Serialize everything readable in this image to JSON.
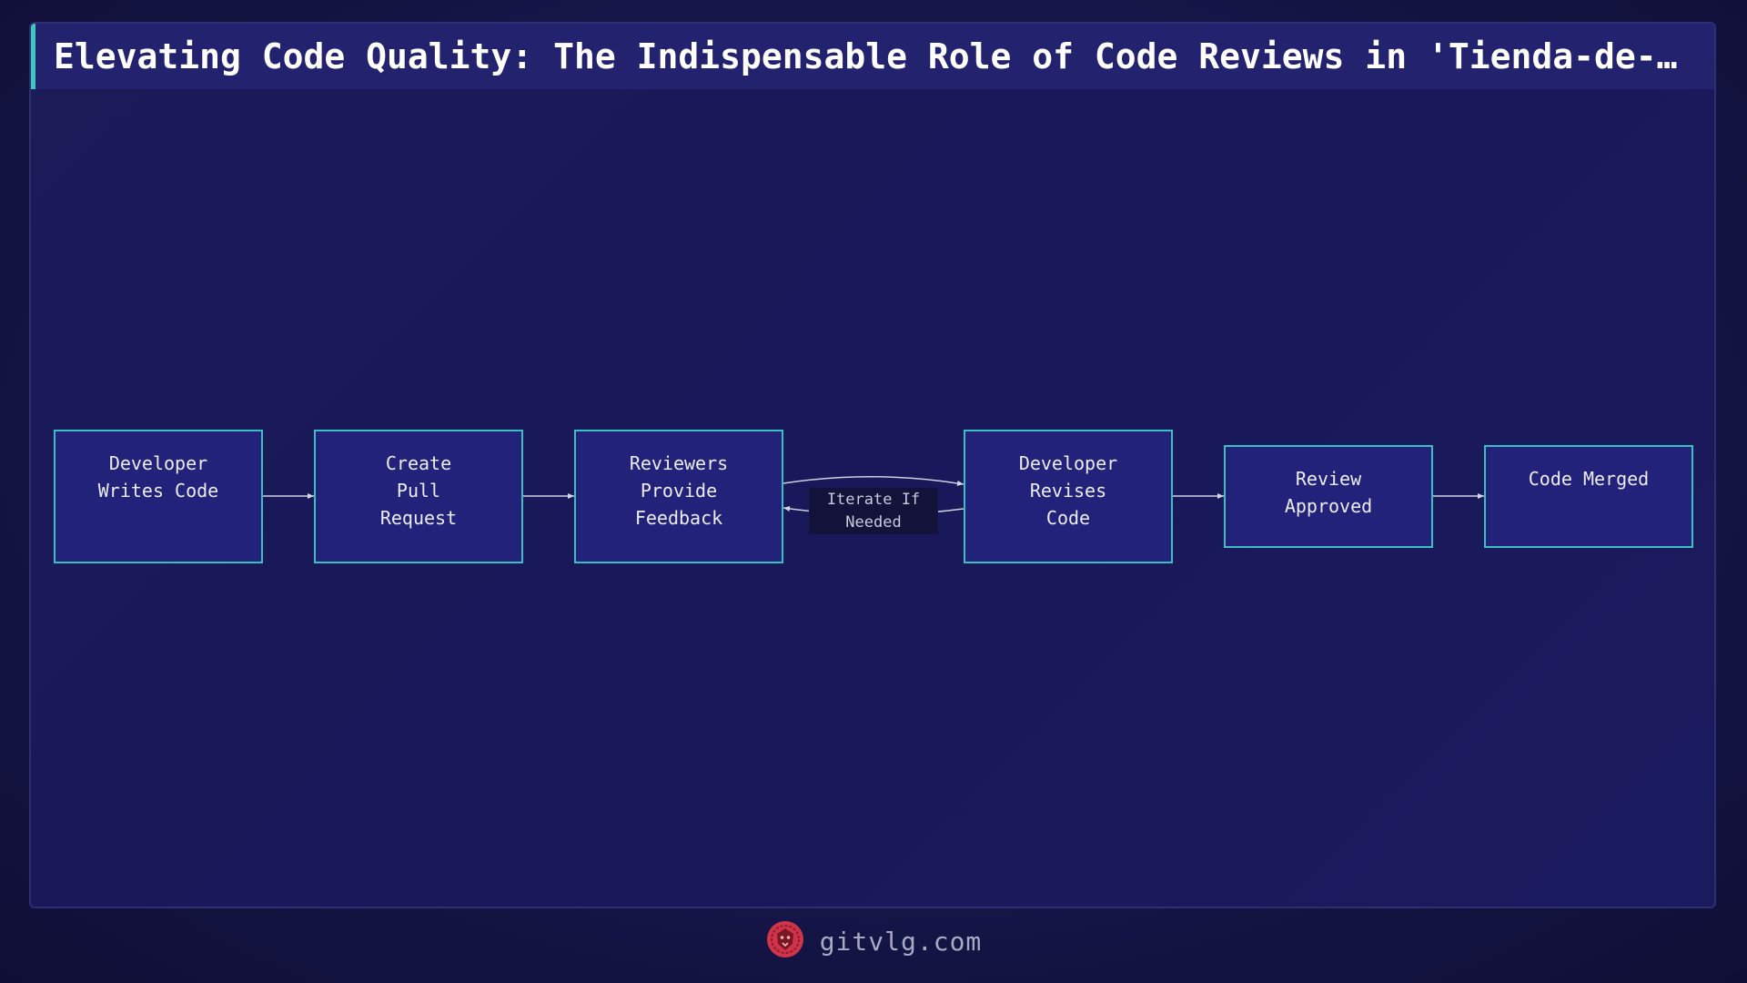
{
  "title": "Elevating Code Quality: The Indispensable Role of Code Reviews in 'Tienda-de-Ro…",
  "nodes": [
    {
      "label": "Developer\nWrites Code"
    },
    {
      "label": "Create\nPull\nRequest"
    },
    {
      "label": "Reviewers\nProvide\nFeedback"
    },
    {
      "label": "Developer\nRevises\nCode"
    },
    {
      "label": "Review\nApproved"
    },
    {
      "label": "Code Merged"
    }
  ],
  "edge_label": "Iterate If\nNeeded",
  "footer": {
    "brand": "gitvlg.com",
    "logo_icon": "lion-head-icon"
  },
  "colors": {
    "node_fill": "#22227a",
    "node_border": "#3bbfc0",
    "accent": "#3ec6c0",
    "logo": "#d0344a"
  }
}
